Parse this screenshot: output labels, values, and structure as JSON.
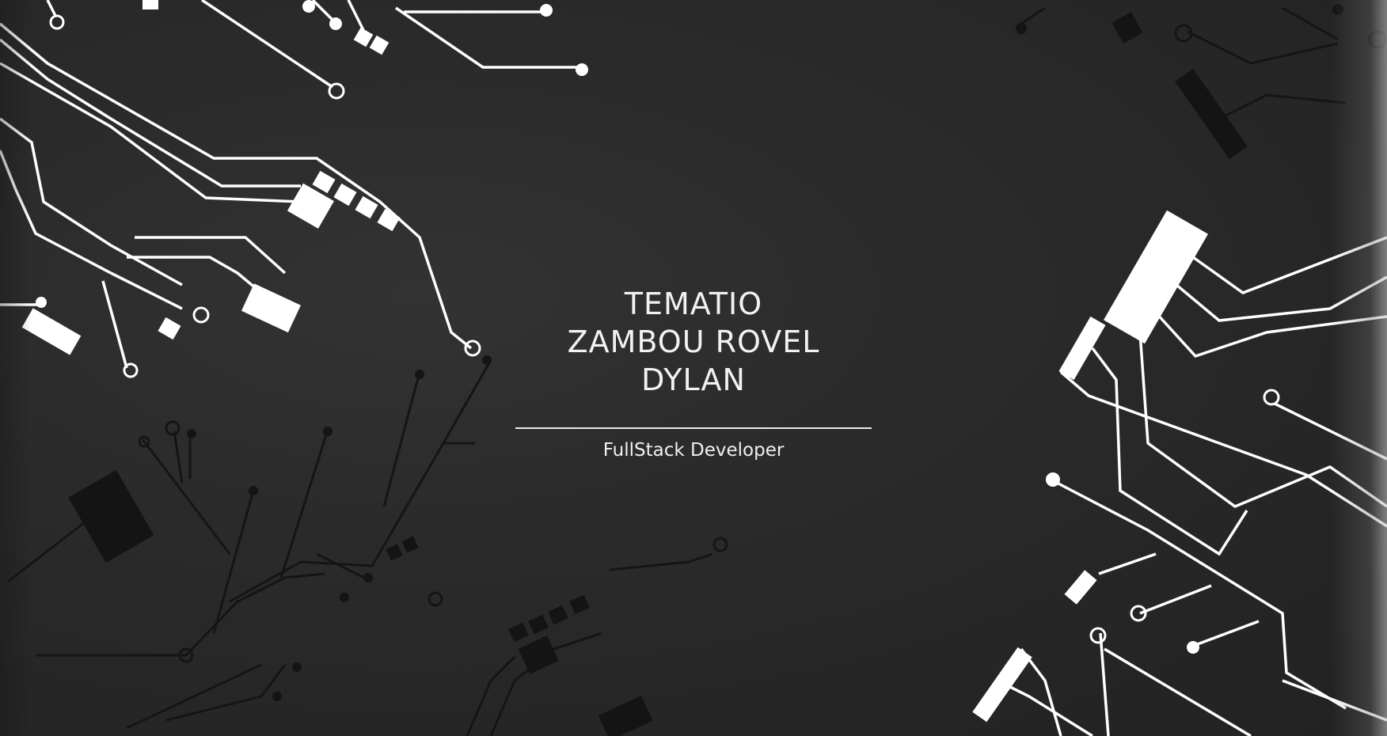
{
  "hero": {
    "name_lines": [
      "TEMATIO",
      "ZAMBOU ROVEL",
      "DYLAN"
    ],
    "subtitle": "FullStack Developer"
  },
  "colors": {
    "background": "#2a2a2a",
    "trace_light": "#ffffff",
    "trace_dark": "#141414",
    "text": "#f2f2f2"
  },
  "background_art": "circuit-board-pattern"
}
